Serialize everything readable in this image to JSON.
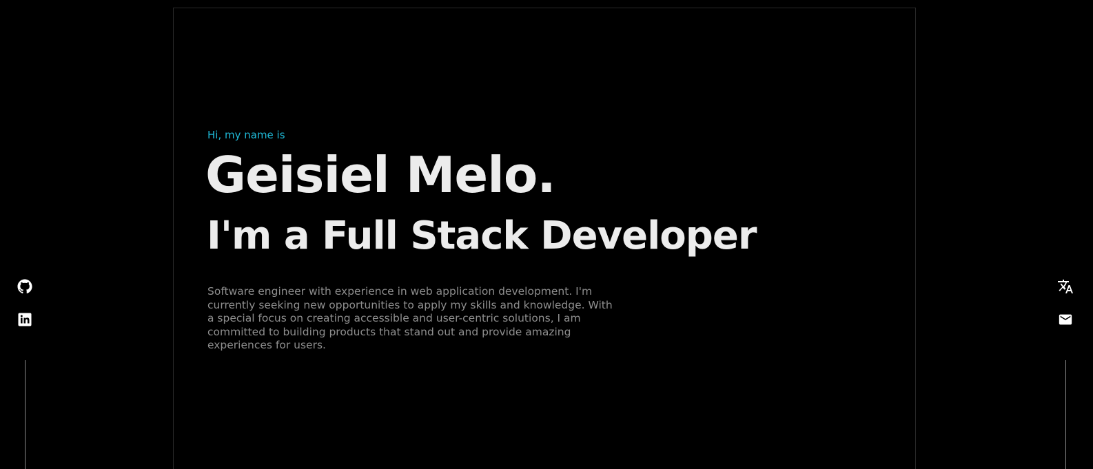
{
  "hero": {
    "greeting": "Hi, my name is",
    "name": "Geisiel Melo.",
    "role": "I'm a Full Stack Developer",
    "bio": "Software engineer with experience in web application development. I'm currently seeking new opportunities to apply my skills and knowledge. With a special focus on creating accessible and user-centric solutions, I am committed to building products that stand out and provide amazing experiences for users."
  },
  "social_left": [
    {
      "icon": "github-icon"
    },
    {
      "icon": "linkedin-icon"
    }
  ],
  "social_right": [
    {
      "icon": "translate-icon"
    },
    {
      "icon": "mail-icon"
    }
  ],
  "colors": {
    "background": "#000000",
    "accent": "#1fb8d6",
    "heading": "#ececec",
    "body_text": "#8e8e8e"
  }
}
